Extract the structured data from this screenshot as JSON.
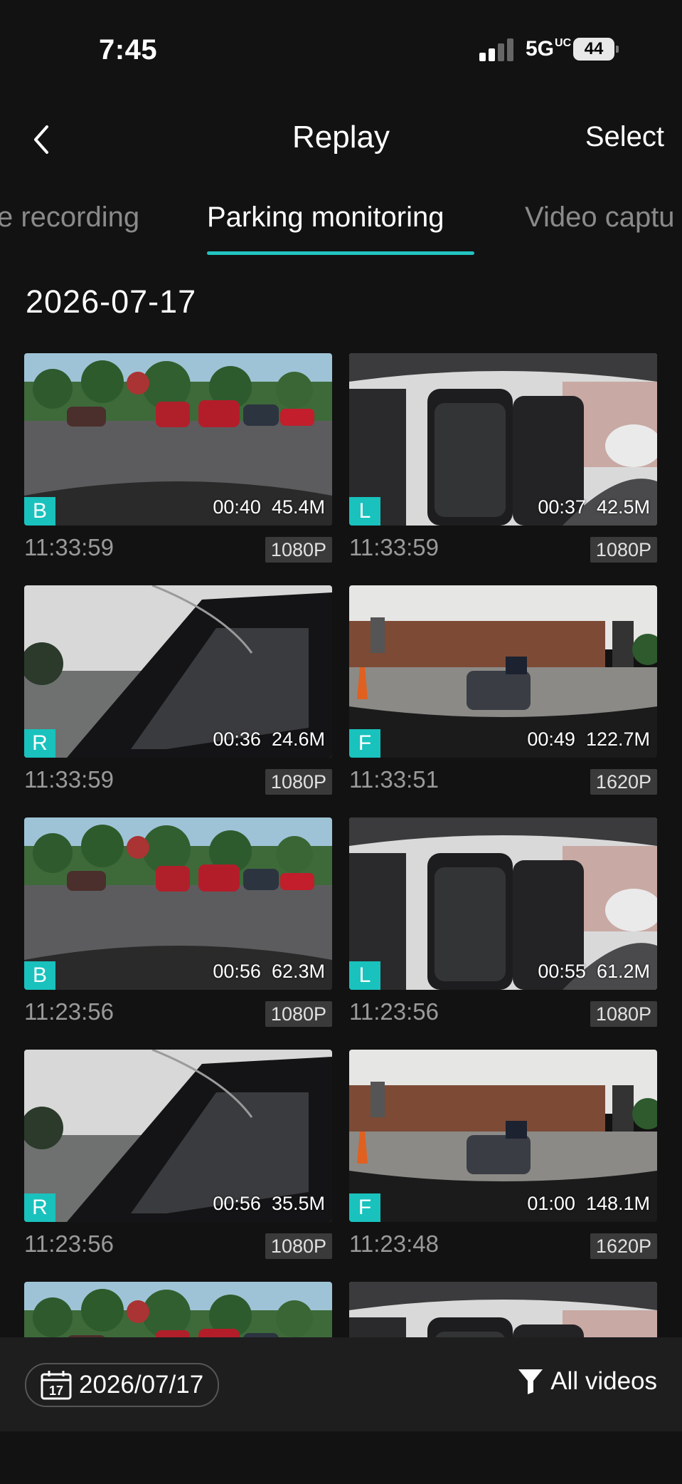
{
  "status_bar": {
    "time": "7:45",
    "network": "5G",
    "network_sub": "UC",
    "battery": "44"
  },
  "header": {
    "title": "Replay",
    "select_label": "Select"
  },
  "tabs": [
    {
      "label": "e recording",
      "active": false
    },
    {
      "label": "Parking monitoring",
      "active": true
    },
    {
      "label": "Video captu",
      "active": false
    }
  ],
  "date_header": "2026-07-17",
  "clips": [
    {
      "camera": "B",
      "duration": "00:40",
      "size": "45.4M",
      "time": "11:33:59",
      "resolution": "1080P",
      "scene": "lot"
    },
    {
      "camera": "L",
      "duration": "00:37",
      "size": "42.5M",
      "time": "11:33:59",
      "resolution": "1080P",
      "scene": "interior"
    },
    {
      "camera": "R",
      "duration": "00:36",
      "size": "24.6M",
      "time": "11:33:59",
      "resolution": "1080P",
      "scene": "side"
    },
    {
      "camera": "F",
      "duration": "00:49",
      "size": "122.7M",
      "time": "11:33:51",
      "resolution": "1620P",
      "scene": "front"
    },
    {
      "camera": "B",
      "duration": "00:56",
      "size": "62.3M",
      "time": "11:23:56",
      "resolution": "1080P",
      "scene": "lot"
    },
    {
      "camera": "L",
      "duration": "00:55",
      "size": "61.2M",
      "time": "11:23:56",
      "resolution": "1080P",
      "scene": "interior"
    },
    {
      "camera": "R",
      "duration": "00:56",
      "size": "35.5M",
      "time": "11:23:56",
      "resolution": "1080P",
      "scene": "side"
    },
    {
      "camera": "F",
      "duration": "01:00",
      "size": "148.1M",
      "time": "11:23:48",
      "resolution": "1620P",
      "scene": "front"
    }
  ],
  "bottom_bar": {
    "date": "2026/07/17",
    "calendar_day": "17",
    "filter_label": "All videos"
  },
  "colors": {
    "accent": "#19c2bd",
    "background": "#121212"
  }
}
